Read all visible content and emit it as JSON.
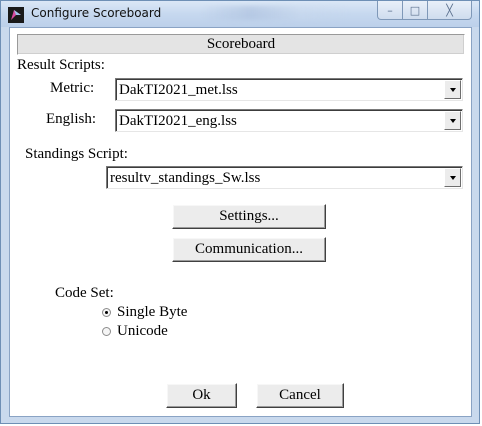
{
  "window": {
    "title": "Configure Scoreboard",
    "minimize_glyph": "–",
    "maximize_glyph": "□",
    "close_glyph": "╳",
    "icon": "app-arrow-icon"
  },
  "panel": {
    "header": "Scoreboard"
  },
  "result_scripts": {
    "label": "Result Scripts:",
    "metric_label": "Metric:",
    "metric_value": "DakTI2021_met.lss",
    "english_label": "English:",
    "english_value": "DakTI2021_eng.lss"
  },
  "standings": {
    "label": "Standings Script:",
    "value": "resultv_standings_Sw.lss"
  },
  "buttons": {
    "settings": "Settings...",
    "communication": "Communication...",
    "ok": "Ok",
    "cancel": "Cancel"
  },
  "code_set": {
    "label": "Code Set:",
    "options": [
      "Single Byte",
      "Unicode"
    ],
    "selected": "Single Byte"
  },
  "colors": {
    "titlebar": "#c6d8ef",
    "frame": "#c9d9ed",
    "client_bg": "#ffffff",
    "header_bg": "#e4e4e4",
    "button_bg": "#ececec"
  }
}
